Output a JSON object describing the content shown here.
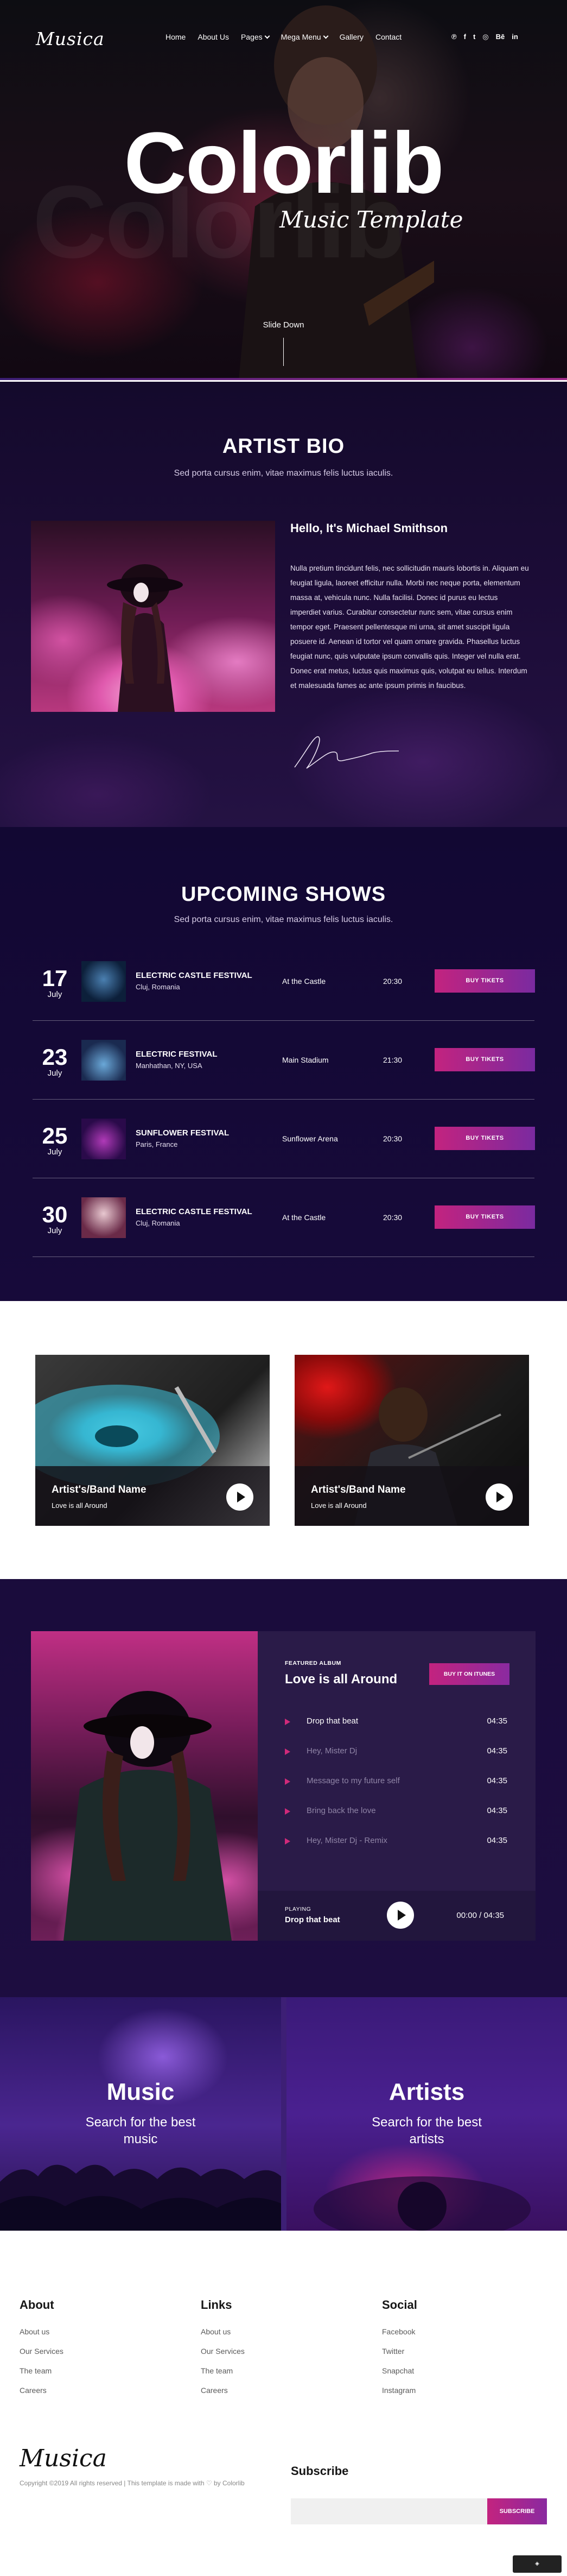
{
  "hero": {
    "logo": "Musica",
    "nav": [
      "Home",
      "About Us",
      "Pages",
      "Mega Menu",
      "Gallery",
      "Contact"
    ],
    "social_icons": [
      "pinterest-icon",
      "facebook-icon",
      "twitter-icon",
      "dribbble-icon",
      "behance-icon",
      "linkedin-icon"
    ],
    "social_glyphs": [
      "℗",
      "f",
      "t",
      "◎",
      "Bē",
      "in"
    ],
    "ghost_text": "CoIorlib",
    "title": "Colorlib",
    "subtitle": "Music Template",
    "slide_down": "Slide Down"
  },
  "bio": {
    "title": "ARTIST BIO",
    "subtitle": "Sed porta cursus enim, vitae maximus felis luctus iaculis.",
    "heading": "Hello, It's Michael Smithson",
    "text": "Nulla pretium tincidunt felis, nec sollicitudin mauris lobortis in. Aliquam eu feugiat ligula, laoreet efficitur nulla. Morbi nec neque porta, elementum massa at, vehicula nunc. Nulla facilisi. Donec id purus eu lectus imperdiet varius. Curabitur consectetur nunc sem, vitae cursus enim tempor eget. Praesent pellentesque mi urna, sit amet suscipit ligula posuere id. Aenean id tortor vel quam ornare gravida. Phasellus luctus feugiat nunc, quis vulputate ipsum convallis quis. Integer vel nulla erat. Donec erat metus, luctus quis maximus quis, volutpat eu tellus. Interdum et malesuada fames ac ante ipsum primis in faucibus."
  },
  "shows": {
    "title": "UPCOMING SHOWS",
    "subtitle": "Sed porta cursus enim, vitae maximus felis luctus iaculis.",
    "items": [
      {
        "day": "17",
        "month": "July",
        "name": "ELECTRIC CASTLE FESTIVAL",
        "place": "Cluj, Romania",
        "venue": "At the Castle",
        "time": "20:30",
        "button": "BUY TIKETS"
      },
      {
        "day": "23",
        "month": "July",
        "name": "ELECTRIC FESTIVAL",
        "place": "Manhathan, NY, USA",
        "venue": "Main Stadium",
        "time": "21:30",
        "button": "BUY TIKETS"
      },
      {
        "day": "25",
        "month": "July",
        "name": "SUNFLOWER FESTIVAL",
        "place": "Paris, France",
        "venue": "Sunflower Arena",
        "time": "20:30",
        "button": "BUY TIKETS"
      },
      {
        "day": "30",
        "month": "July",
        "name": "ELECTRIC CASTLE FESTIVAL",
        "place": "Cluj, Romania",
        "venue": "At the Castle",
        "time": "20:30",
        "button": "BUY TIKETS"
      }
    ]
  },
  "cards": [
    {
      "title": "Artist's/Band Name",
      "subtitle": "Love is all Around"
    },
    {
      "title": "Artist's/Band Name",
      "subtitle": "Love is all Around"
    }
  ],
  "album": {
    "kicker": "FEATURED ALBUM",
    "title": "Love is all Around",
    "button": "BUY IT ON ITUNES",
    "tracks": [
      {
        "name": "Drop that beat",
        "duration": "04:35",
        "active": true
      },
      {
        "name": "Hey, Mister Dj",
        "duration": "04:35",
        "active": false
      },
      {
        "name": "Message to my future self",
        "duration": "04:35",
        "active": false
      },
      {
        "name": "Bring back the love",
        "duration": "04:35",
        "active": false
      },
      {
        "name": "Hey, Mister Dj - Remix",
        "duration": "04:35",
        "active": false
      }
    ],
    "now_playing_label": "PLAYING",
    "now_playing_title": "Drop that beat",
    "time": "00:00 / 04:35"
  },
  "promo": [
    {
      "title": "Music",
      "text": "Search for the best music"
    },
    {
      "title": "Artists",
      "text": "Search for the best artists"
    }
  ],
  "footer": {
    "columns": [
      {
        "title": "About",
        "links": [
          "About us",
          "Our Services",
          "The team",
          "Careers"
        ]
      },
      {
        "title": "Links",
        "links": [
          "About us",
          "Our Services",
          "The team",
          "Careers"
        ]
      },
      {
        "title": "Social",
        "links": [
          "Facebook",
          "Twitter",
          "Snapchat",
          "Instagram"
        ]
      }
    ],
    "logo": "Musica",
    "copyright": "Copyright ©2019 All rights reserved | This template is made with ♡ by Colorlib",
    "subscribe_title": "Subscribe",
    "subscribe_button": "SUBSCRIBE"
  },
  "colors": {
    "accent_pink": "#c3237f",
    "accent_purple": "#7a2aa0",
    "dark_navy": "#170a3a"
  }
}
